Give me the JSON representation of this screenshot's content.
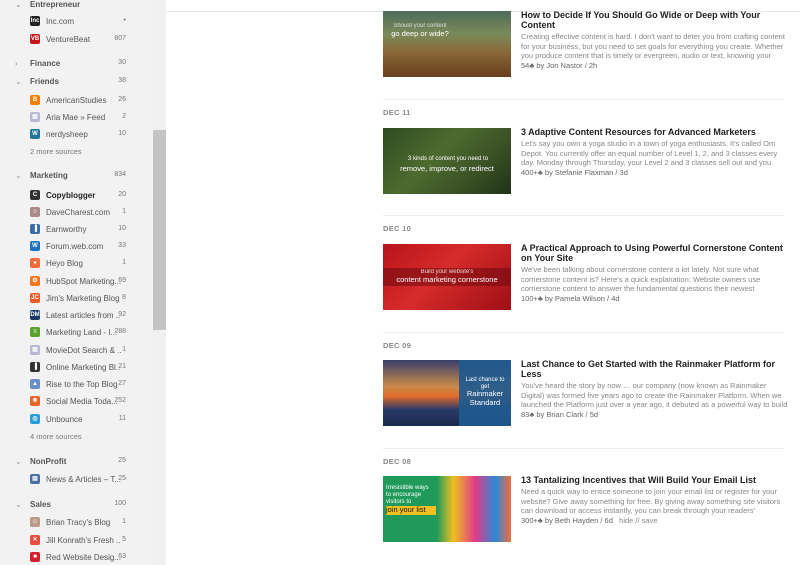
{
  "sidebar": {
    "groups": [
      {
        "name": "Entrepreneur",
        "count": "",
        "expanded": true,
        "top": 0,
        "sources": [
          {
            "name": "Inc.com",
            "count": "•",
            "icon": "inc-icon",
            "color": "#222"
          },
          {
            "name": "VentureBeat",
            "count": "807",
            "icon": "venturebeat-icon",
            "color": "#c4161c"
          }
        ]
      },
      {
        "name": "Finance",
        "count": "30",
        "expanded": false,
        "sources": []
      },
      {
        "name": "Friends",
        "count": "38",
        "expanded": true,
        "sources": [
          {
            "name": "AmericanStudies",
            "count": "26",
            "icon": "blogger-icon",
            "color": "#f57d00"
          },
          {
            "name": "Aria Mae » Feed",
            "count": "2",
            "icon": "feed-icon",
            "color": "#b9b9d6"
          },
          {
            "name": "nerdysheep",
            "count": "10",
            "icon": "wordpress-icon",
            "color": "#21759b"
          }
        ],
        "more": "2 more sources"
      },
      {
        "name": "Marketing",
        "count": "834",
        "expanded": true,
        "sources": [
          {
            "name": "Copyblogger",
            "count": "20",
            "icon": "copyblogger-icon",
            "color": "#333",
            "bold": true
          },
          {
            "name": "DaveCharest.com",
            "count": "1",
            "icon": "avatar-icon",
            "color": "#a88"
          },
          {
            "name": "Earnworthy",
            "count": "10",
            "icon": "bar-chart-icon",
            "color": "#3a6ea5"
          },
          {
            "name": "Forum.web.com",
            "count": "33",
            "icon": "web-icon",
            "color": "#1e73be"
          },
          {
            "name": "Heyo Blog",
            "count": "1",
            "icon": "heyo-icon",
            "color": "#f26c3a"
          },
          {
            "name": "HubSpot Marketing...",
            "count": "69",
            "icon": "hubspot-icon",
            "color": "#f57722"
          },
          {
            "name": "Jim's Marketing Blog",
            "count": "8",
            "icon": "jc-icon",
            "color": "#e85c2c"
          },
          {
            "name": "Latest articles from ...",
            "count": "92",
            "icon": "dm-icon",
            "color": "#1a3a6a"
          },
          {
            "name": "Marketing Land - I...",
            "count": "288",
            "icon": "wifi-icon",
            "color": "#5aa02c"
          },
          {
            "name": "MovieDot Search & ...",
            "count": "1",
            "icon": "feed-icon",
            "color": "#b9b9d6"
          },
          {
            "name": "Online Marketing Bl...",
            "count": "21",
            "icon": "omb-icon",
            "color": "#333"
          },
          {
            "name": "Rise to the Top Blog",
            "count": "27",
            "icon": "mountain-icon",
            "color": "#6a8fc7"
          },
          {
            "name": "Social Media Toda...",
            "count": "252",
            "icon": "smt-icon",
            "color": "#e8662c"
          },
          {
            "name": "Unbounce",
            "count": "11",
            "icon": "unbounce-icon",
            "color": "#2a9fd6"
          }
        ],
        "more": "4 more sources"
      },
      {
        "name": "NonProfit",
        "count": "25",
        "expanded": true,
        "sources": [
          {
            "name": "News & Articles – T...",
            "count": "25",
            "icon": "news-icon",
            "color": "#4a6fa5"
          }
        ]
      },
      {
        "name": "Sales",
        "count": "100",
        "expanded": true,
        "sources": [
          {
            "name": "Brian Tracy's Blog",
            "count": "1",
            "icon": "avatar-icon",
            "color": "#b98"
          },
          {
            "name": "Jill Konrath's Fresh ...",
            "count": "5",
            "icon": "jk-icon",
            "color": "#e74c3c"
          },
          {
            "name": "Red Website Desig...",
            "count": "63",
            "icon": "red-icon",
            "color": "#d0202e"
          }
        ]
      }
    ]
  },
  "articles": [
    {
      "date": "",
      "title": "How to Decide If You Should Go Wide or Deep with Your Content",
      "summary": "Creating effective content is hard. I don't want to deter you from crafting content for your business, but you need to set goals for everything you create. Whether you produce content that is timely or evergreen, audio or text, knowing your",
      "count": "54♣",
      "by": "by Jon Nastor / 2h",
      "thumb_over": "Should your content",
      "thumb_text": "go deep or wide?",
      "thumb_bg": "canyon",
      "actions": ""
    },
    {
      "date": "DEC 11",
      "title": "3 Adaptive Content Resources for Advanced Marketers",
      "summary": "Let's say you own a yoga studio in a town of yoga enthusiasts. It's called Om Depot. You currently offer an equal number of Level 1, 2, and 3 classes every day. Monday through Thursday, your Level 2 and 3 classes sell out and you",
      "count": "400+♣",
      "by": "by Stefanie Flaxman / 3d",
      "thumb_over": "3 kinds of content you need to",
      "thumb_text": "remove, improve, or redirect",
      "thumb_bg": "garden",
      "actions": ""
    },
    {
      "date": "DEC 10",
      "title": "A Practical Approach to Using Powerful Cornerstone Content on Your Site",
      "summary": "We've been talking about cornerstone content a lot lately. Not sure what cornerstone content is? Here's a quick explanation: Website owners use cornerstone content to answer the fundamental questions their newest",
      "count": "100+♣",
      "by": "by Pamela Wilson / 4d",
      "thumb_over": "Build your website's",
      "thumb_text": "content marketing cornerstone",
      "thumb_bg": "red",
      "actions": ""
    },
    {
      "date": "DEC 09",
      "title": "Last Chance to Get Started with the Rainmaker Platform for Less",
      "summary": "You've heard the story by now … our company (now known as Rainmaker Digital) was formed five years ago to create the Rainmaker Platform. When we launched the Platform just over a year ago, it debuted as a powerful way to build",
      "count": "83♣",
      "by": "by Brian Clark / 5d",
      "thumb_over": "Last chance to get",
      "thumb_text": "Rainmaker Standard",
      "thumb_bg": "sunset",
      "actions": ""
    },
    {
      "date": "DEC 08",
      "title": "13 Tantalizing Incentives that Will Build Your Email List",
      "summary": "Need a quick way to entice someone to join your email list or register for your website? Give away something for free. By giving away something site visitors can download or access instantly, you can break through your readers'",
      "count": "300+♣",
      "by": "by Beth Hayden / 6d",
      "thumb_over": "Irresistible ways to encourage visitors to",
      "thumb_text": "join your list",
      "thumb_bg": "gifts",
      "actions": "hide  //  save"
    }
  ]
}
